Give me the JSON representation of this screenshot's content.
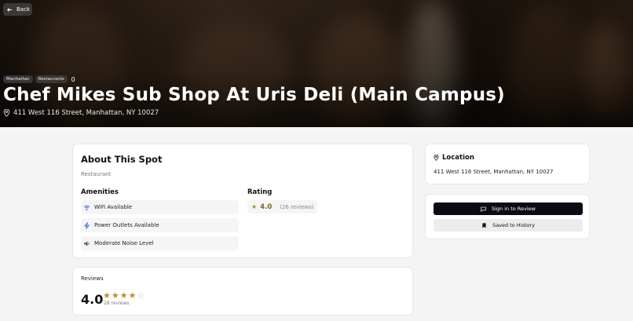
{
  "nav": {
    "back_label": "Back"
  },
  "place": {
    "tags": [
      "Manhattan",
      "Restaurants"
    ],
    "tag_extra": "0",
    "name": "Chef Mikes Sub Shop At Uris Deli (Main Campus)",
    "address": "411 West 116 Street, Manhattan, NY 10027"
  },
  "about": {
    "title": "About This Spot",
    "category": "Restaurant",
    "amenities_title": "Amenities",
    "amenities": [
      {
        "icon": "wifi-icon",
        "label": "WiFi Available"
      },
      {
        "icon": "lightning-icon",
        "label": "Power Outlets Available"
      },
      {
        "icon": "speaker-icon",
        "label": "Moderate Noise Level"
      }
    ],
    "rating_title": "Rating",
    "rating_value": "4.0",
    "rating_count": "(26 reviews)"
  },
  "reviews": {
    "title": "Reviews",
    "average": "4.0",
    "stars_filled": 4,
    "stars_total": 5,
    "count_label": "28 reviews"
  },
  "location": {
    "title": "Location",
    "address": "411 West 116 Street, Manhattan, NY 10027"
  },
  "actions": {
    "sign_in_label": "Sign in to Review",
    "saved_label": "Saved to History"
  },
  "colors": {
    "primary_button": "#0b0b16",
    "star": "#b7922b",
    "amenity_icon": "#3b5bdb"
  }
}
